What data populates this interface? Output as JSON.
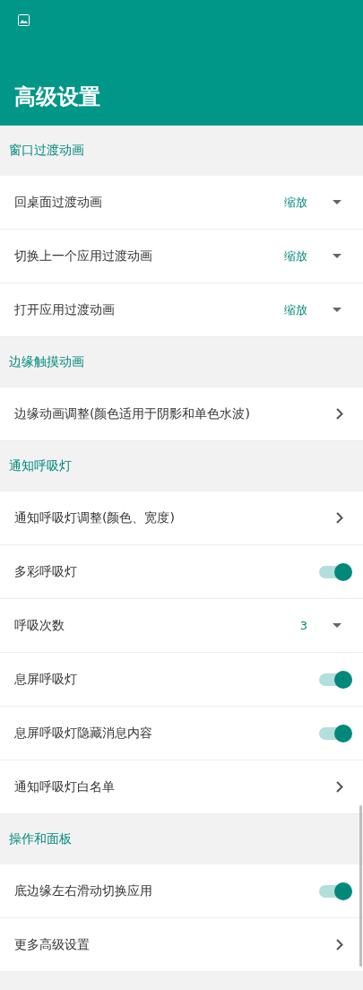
{
  "header": {
    "title": "高级设置"
  },
  "sections": [
    {
      "title": "窗口过渡动画",
      "items": [
        {
          "kind": "dropdown",
          "label": "回桌面过渡动画",
          "value": "缩放"
        },
        {
          "kind": "dropdown",
          "label": "切换上一个应用过渡动画",
          "value": "缩放"
        },
        {
          "kind": "dropdown",
          "label": "打开应用过渡动画",
          "value": "缩放"
        }
      ]
    },
    {
      "title": "边缘触摸动画",
      "items": [
        {
          "kind": "link",
          "label": "边缘动画调整(颜色适用于阴影和单色水波)"
        }
      ]
    },
    {
      "title": "通知呼吸灯",
      "items": [
        {
          "kind": "link",
          "label": "通知呼吸灯调整(颜色、宽度)"
        },
        {
          "kind": "switch",
          "label": "多彩呼吸灯",
          "on": true
        },
        {
          "kind": "dropdown",
          "label": "呼吸次数",
          "value": "3"
        },
        {
          "kind": "switch",
          "label": "息屏呼吸灯",
          "on": true
        },
        {
          "kind": "switch",
          "label": "息屏呼吸灯隐藏消息内容",
          "on": true
        },
        {
          "kind": "link",
          "label": "通知呼吸灯白名单"
        }
      ]
    },
    {
      "title": "操作和面板",
      "items": [
        {
          "kind": "switch",
          "label": "底边缘左右滑动切换应用",
          "on": true
        },
        {
          "kind": "link",
          "label": "更多高级设置"
        }
      ]
    }
  ]
}
